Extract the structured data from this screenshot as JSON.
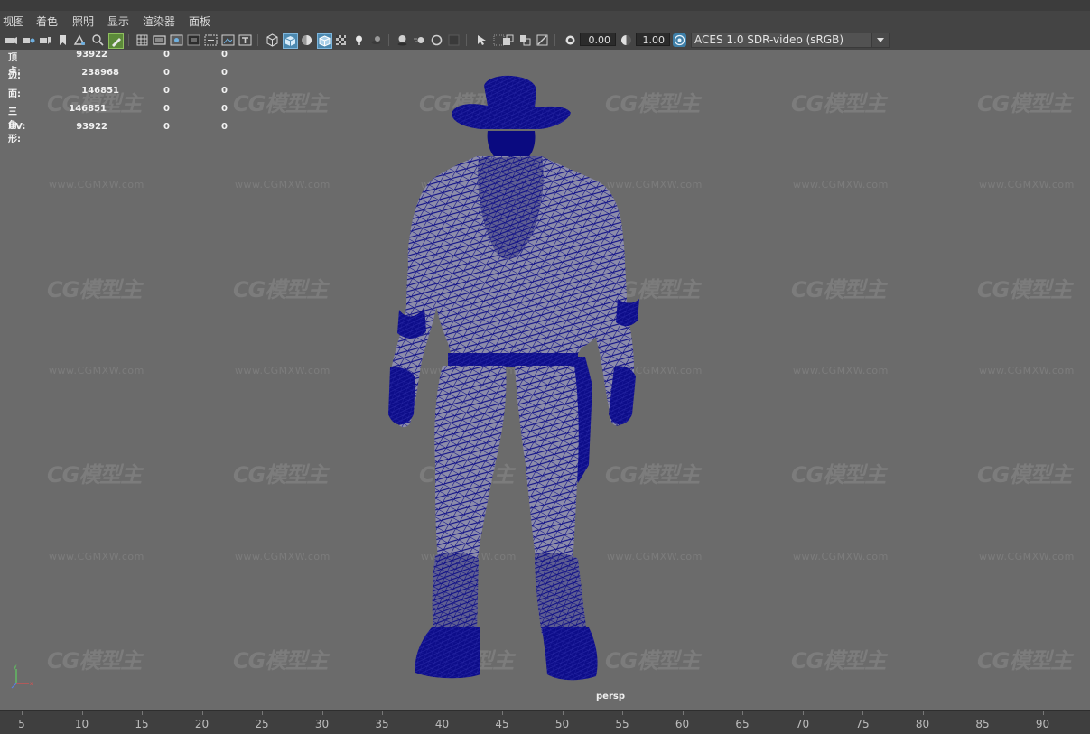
{
  "menu": [
    "视图",
    "着色",
    "照明",
    "显示",
    "渲染器",
    "面板"
  ],
  "toolbar": {
    "exposure_value": "0.00",
    "gamma_value": "1.00",
    "color_space": "ACES 1.0 SDR-video (sRGB)"
  },
  "hud": {
    "rows": [
      {
        "label": "顶点:",
        "total": "93922",
        "sel": "0",
        "comp": "0"
      },
      {
        "label": "边:",
        "total": "238968",
        "sel": "0",
        "comp": "0"
      },
      {
        "label": "面:",
        "total": "146851",
        "sel": "0",
        "comp": "0"
      },
      {
        "label": "三角形:",
        "total": "146851",
        "sel": "0",
        "comp": "0"
      },
      {
        "label": "UV:",
        "total": "93922",
        "sel": "0",
        "comp": "0"
      }
    ]
  },
  "viewport": {
    "camera": "persp",
    "mesh_color": "#0a0a86",
    "background_color": "#6b6b6b"
  },
  "watermark": {
    "logo": "CG模型主",
    "url": "www.CGMXW.com"
  },
  "timeline": {
    "ticks": [
      "5",
      "10",
      "15",
      "20",
      "25",
      "30",
      "35",
      "40",
      "45",
      "50",
      "55",
      "60",
      "65",
      "70",
      "75",
      "80",
      "85",
      "90"
    ]
  }
}
